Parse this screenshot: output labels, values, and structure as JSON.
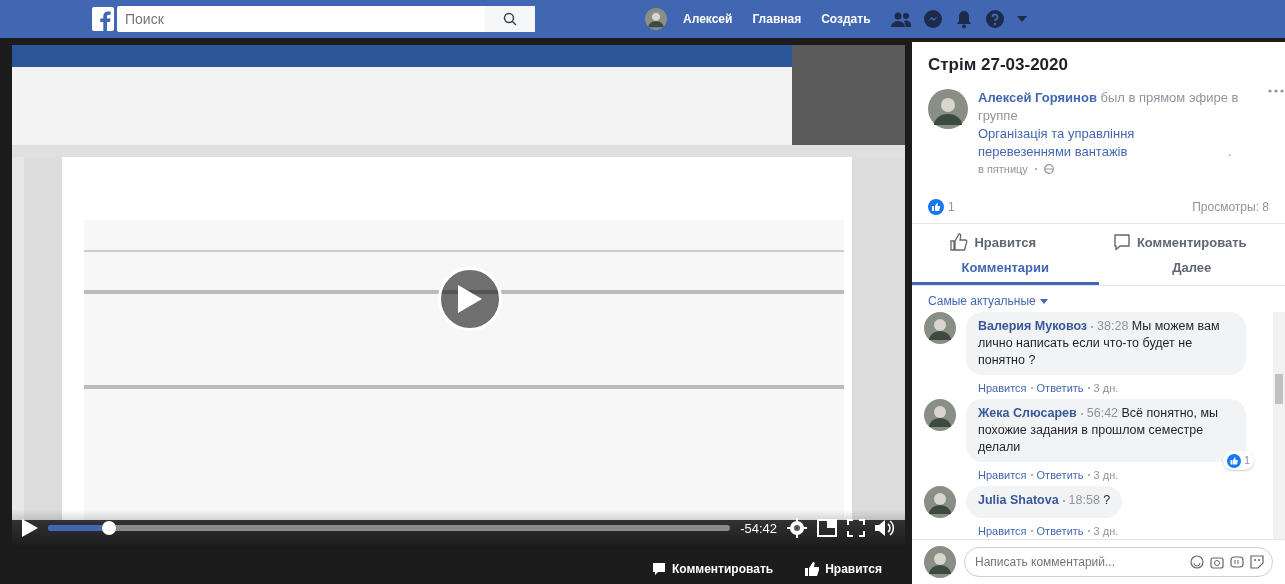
{
  "topbar": {
    "search": {
      "placeholder": "Поиск"
    },
    "user": "Алексей",
    "links": [
      "Главная",
      "Создать"
    ]
  },
  "player": {
    "level": 0.09,
    "time": "-54:42"
  },
  "footer": {
    "actions": [
      "Комментировать",
      "Нравится"
    ]
  },
  "post": {
    "title": "Стрім 27-03-2020",
    "author": "Алексей Горяинов",
    "text": "был в прямом эфире в группе",
    "group": "Організація та управління перевезеннями вантажів",
    "after": ".",
    "time": "в пятницу",
    "likes": "1",
    "views": "Просмотры: 8",
    "actions": [
      {
        "kind": "like",
        "label": "Нравится"
      },
      {
        "kind": "comment",
        "label": "Комментировать"
      }
    ],
    "tabs": [
      {
        "label": "Комментарии",
        "selected": true
      },
      {
        "label": "Далее",
        "selected": false
      }
    ]
  },
  "sort": "Самые актуальные",
  "comments": [
    {
      "author": "Валерия Муковоз",
      "time": "38:28",
      "text": "Мы можем вам лично написать если что-то будет не понятно ?",
      "meta": [
        "Нравится",
        "Ответить",
        "3 дн."
      ]
    },
    {
      "author": "Жека Слюсарев",
      "time": "56:42",
      "text": "Всё понятно, мы похожие задания в прошлом семестре делали",
      "reactions": "1",
      "meta": [
        "Нравится",
        "Ответить",
        "3 дн."
      ]
    },
    {
      "author": "Julia Shatova",
      "time": "18:58",
      "text": "?",
      "meta": [
        "Нравится",
        "Ответить",
        "3 дн."
      ]
    }
  ],
  "composer": {
    "placeholder": "Написать комментарий..."
  }
}
